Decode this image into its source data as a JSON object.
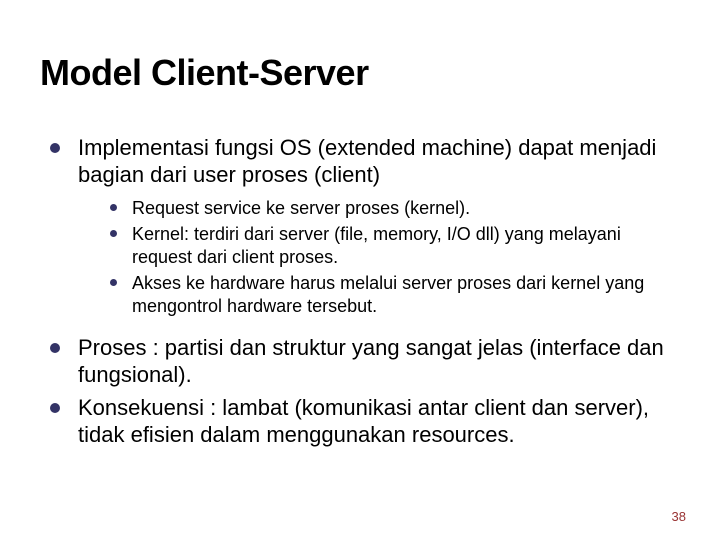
{
  "title": "Model Client-Server",
  "bullets": {
    "item1": "Implementasi fungsi OS (extended machine) dapat menjadi bagian dari user proses (client)",
    "sub1": "Request service ke server proses (kernel).",
    "sub2": "Kernel: terdiri dari server (file, memory, I/O dll) yang melayani request dari client proses.",
    "sub3": "Akses ke hardware harus melalui server proses dari kernel yang mengontrol hardware tersebut.",
    "item2": "Proses : partisi dan struktur yang sangat jelas (interface dan fungsional).",
    "item3": "Konsekuensi : lambat (komunikasi antar client dan server), tidak efisien dalam menggunakan resources."
  },
  "page_number": "38"
}
